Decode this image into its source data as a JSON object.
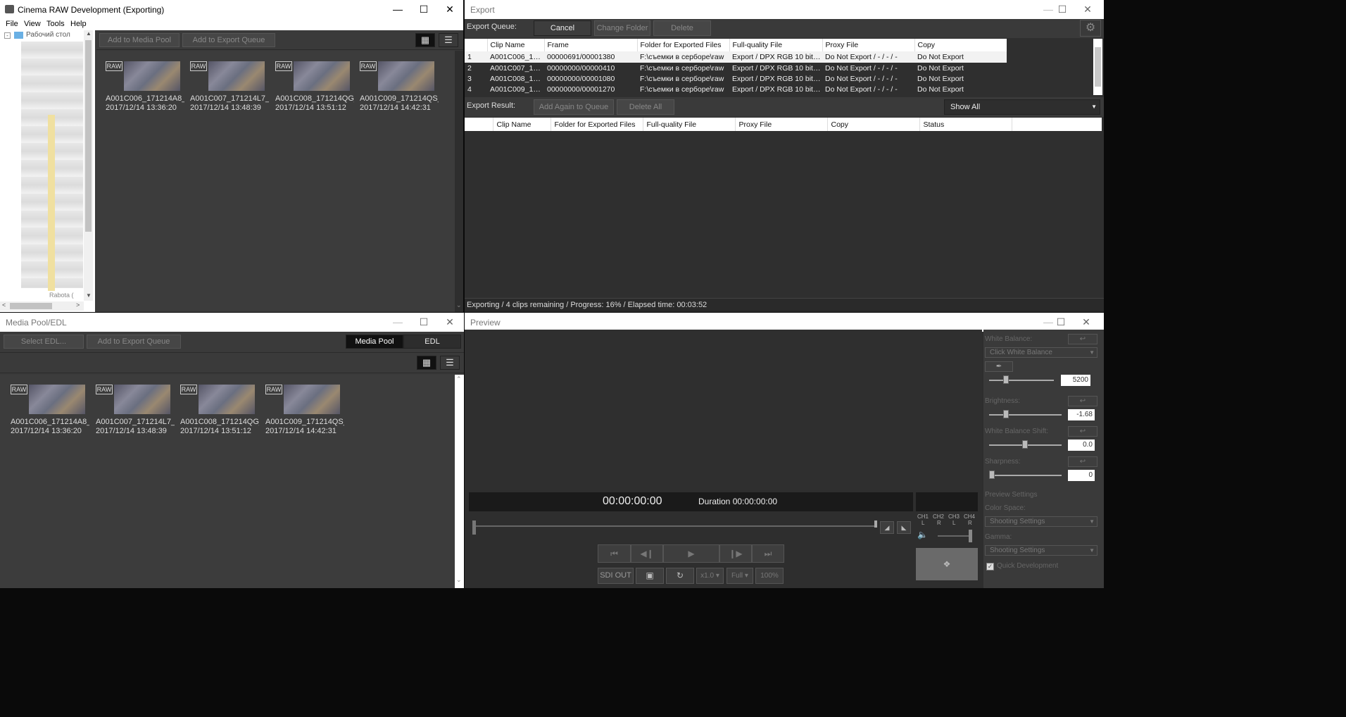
{
  "main_window": {
    "title": "Cinema RAW Development (Exporting)",
    "menu": [
      "File",
      "View",
      "Tools",
      "Help"
    ],
    "tree_root": "Рабочий стол",
    "tree_partial": "Rabota (",
    "toolbar": {
      "add_media_pool": "Add to Media Pool",
      "add_export_queue": "Add to Export Queue"
    },
    "clips": [
      {
        "raw": "RAW",
        "name": "A001C006_171214A8_l...",
        "date": "2017/12/14 13:36:20"
      },
      {
        "raw": "RAW",
        "name": "A001C007_171214L7_l...",
        "date": "2017/12/14 13:48:39"
      },
      {
        "raw": "RAW",
        "name": "A001C008_171214QG_...",
        "date": "2017/12/14 13:51:12"
      },
      {
        "raw": "RAW",
        "name": "A001C009_171214QS_...",
        "date": "2017/12/14 14:42:31"
      }
    ]
  },
  "media_pool": {
    "title": "Media Pool/EDL",
    "select_edl": "Select EDL...",
    "add_export_queue": "Add to Export Queue",
    "tab_media_pool": "Media Pool",
    "tab_edl": "EDL",
    "clips": [
      {
        "raw": "RAW",
        "name": "A001C006_171214A8_l...",
        "date": "2017/12/14 13:36:20"
      },
      {
        "raw": "RAW",
        "name": "A001C007_171214L7_l...",
        "date": "2017/12/14 13:48:39"
      },
      {
        "raw": "RAW",
        "name": "A001C008_171214QG_...",
        "date": "2017/12/14 13:51:12"
      },
      {
        "raw": "RAW",
        "name": "A001C009_171214QS_...",
        "date": "2017/12/14 14:42:31"
      }
    ]
  },
  "export": {
    "title": "Export",
    "queue_label": "Export Queue:",
    "cancel": "Cancel",
    "change_folder": "Change Folder",
    "delete": "Delete",
    "queue_headers": [
      "",
      "Clip Name",
      "Frame",
      "Folder for Exported Files",
      "Full-quality File",
      "Proxy File",
      "Copy"
    ],
    "queue_rows": [
      [
        "1",
        "A001C006_171...",
        "00000691/00001380",
        "F:\\съемки в серборе\\raw",
        "Export / DPX RGB 10 bit / ...",
        "Do Not Export / - / - / -",
        "Do Not Export"
      ],
      [
        "2",
        "A001C007_171...",
        "00000000/00000410",
        "F:\\съемки в серборе\\raw",
        "Export / DPX RGB 10 bit / ...",
        "Do Not Export / - / - / -",
        "Do Not Export"
      ],
      [
        "3",
        "A001C008_171...",
        "00000000/00001080",
        "F:\\съемки в серборе\\raw",
        "Export / DPX RGB 10 bit / ...",
        "Do Not Export / - / - / -",
        "Do Not Export"
      ],
      [
        "4",
        "A001C009_171...",
        "00000000/00001270",
        "F:\\съемки в серборе\\raw",
        "Export / DPX RGB 10 bit / ...",
        "Do Not Export / - / - / -",
        "Do Not Export"
      ]
    ],
    "result_label": "Export Result:",
    "add_again": "Add Again to Queue",
    "delete_all": "Delete All",
    "filter": "Show All",
    "result_headers": [
      "",
      "Clip Name",
      "Folder for Exported Files",
      "Full-quality File",
      "Proxy File",
      "Copy",
      "Status"
    ],
    "status": "Exporting / 4 clips remaining / Progress: 16% / Elapsed time: 00:03:52"
  },
  "preview": {
    "title": "Preview",
    "timecode": "00:00:00:00",
    "duration": "Duration 00:00:00:00",
    "channels": [
      "CH1",
      "CH2",
      "CH3",
      "CH4"
    ],
    "channel_sides": [
      "L",
      "R",
      "L",
      "R"
    ],
    "sdi_out": "SDI OUT",
    "speed": "x1.0",
    "full": "Full",
    "zoom": "100%",
    "white_balance": "White Balance:",
    "click_wb": "Click White Balance",
    "wb_value": "5200",
    "brightness": "Brightness:",
    "brightness_value": "-1.68",
    "wb_shift": "White Balance Shift:",
    "wb_shift_value": "0.0",
    "sharpness": "Sharpness:",
    "sharpness_value": "0",
    "preview_settings": "Preview Settings",
    "color_space": "Color Space:",
    "color_space_value": "Shooting Settings",
    "gamma": "Gamma:",
    "gamma_value": "Shooting Settings",
    "quick_dev": "Quick Development"
  }
}
